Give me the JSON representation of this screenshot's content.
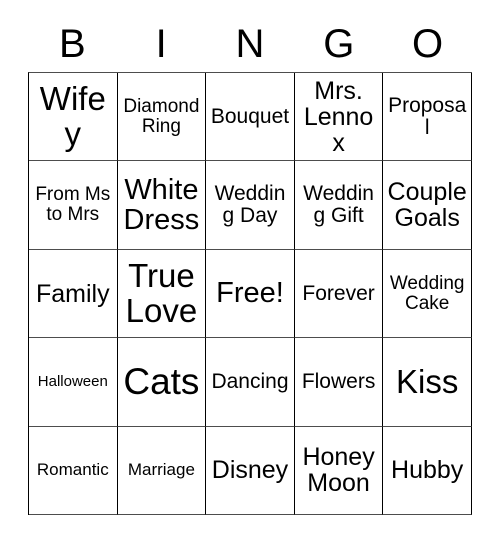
{
  "header": {
    "letters": [
      "B",
      "I",
      "N",
      "G",
      "O"
    ]
  },
  "colors": {
    "background": "#ffffff",
    "text": "#000000",
    "grid_line": "#4d4d4d",
    "border": "#000000"
  },
  "grid": {
    "columns": 5,
    "rows": 5,
    "free_space": "Free!",
    "cells": [
      [
        {
          "label": "Wifey",
          "size": "fs-3xl"
        },
        {
          "label": "Diamond Ring",
          "size": "fs-md"
        },
        {
          "label": "Bouquet",
          "size": "fs-lg"
        },
        {
          "label": "Mrs. Lennox",
          "size": "fs-xl"
        },
        {
          "label": "Proposal",
          "size": "fs-lg"
        }
      ],
      [
        {
          "label": "From Ms to Mrs",
          "size": "fs-md"
        },
        {
          "label": "White Dress",
          "size": "fs-2xl"
        },
        {
          "label": "Wedding Day",
          "size": "fs-lg"
        },
        {
          "label": "Wedding Gift",
          "size": "fs-lg"
        },
        {
          "label": "Couple Goals",
          "size": "fs-xl"
        }
      ],
      [
        {
          "label": "Family",
          "size": "fs-xl"
        },
        {
          "label": "True Love",
          "size": "fs-3xl"
        },
        {
          "label": "Free!",
          "size": "fs-2xl"
        },
        {
          "label": "Forever",
          "size": "fs-lg"
        },
        {
          "label": "Wedding Cake",
          "size": "fs-md"
        }
      ],
      [
        {
          "label": "Halloween",
          "size": "fs-xs"
        },
        {
          "label": "Cats",
          "size": "fs-4xl"
        },
        {
          "label": "Dancing",
          "size": "fs-lg"
        },
        {
          "label": "Flowers",
          "size": "fs-lg"
        },
        {
          "label": "Kiss",
          "size": "fs-3xl"
        }
      ],
      [
        {
          "label": "Romantic",
          "size": "fs-sm"
        },
        {
          "label": "Marriage",
          "size": "fs-sm"
        },
        {
          "label": "Disney",
          "size": "fs-xl"
        },
        {
          "label": "Honey Moon",
          "size": "fs-xl"
        },
        {
          "label": "Hubby",
          "size": "fs-xl"
        }
      ]
    ]
  }
}
